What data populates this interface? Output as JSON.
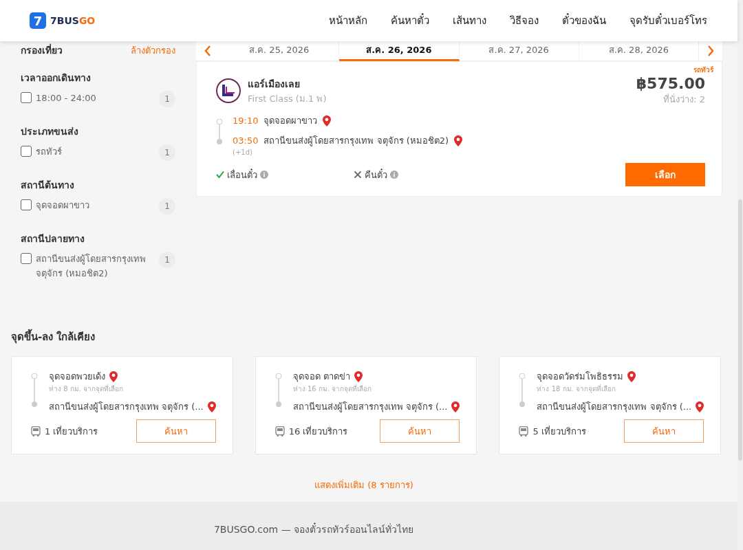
{
  "header": {
    "logo_mark": "7",
    "logo_text_main": "7BUS",
    "logo_text_accent": "GO",
    "nav": [
      "หน้าหลัก",
      "ค้นหาตั๋ว",
      "เส้นทาง",
      "วิธีจอง",
      "ตั๋วของฉัน",
      "จุดรับตั๋วเบอร์โทร"
    ]
  },
  "filters": {
    "title": "กรองเที่ยว",
    "clear": "ล้างตัวกรอง",
    "groups": [
      {
        "title": "เวลาออกเดินทาง",
        "options": [
          {
            "label": "18:00 - 24:00",
            "count": "1",
            "checked": false
          }
        ]
      },
      {
        "title": "ประเภทขนส่ง",
        "options": [
          {
            "label": "รถทัวร์",
            "count": "1",
            "checked": false
          }
        ]
      },
      {
        "title": "สถานีต้นทาง",
        "options": [
          {
            "label": "จุดจอดผาขาว",
            "count": "1",
            "checked": false
          }
        ]
      },
      {
        "title": "สถานีปลายทาง",
        "options": [
          {
            "label": "สถานีขนส่งผู้โดยสารกรุงเทพ จตุจักร (หมอชิต2)",
            "count": "1",
            "checked": false
          }
        ]
      }
    ]
  },
  "date_tabs": [
    {
      "label": "ส.ค. 25, 2026",
      "selected": false
    },
    {
      "label": "ส.ค. 26, 2026",
      "selected": true
    },
    {
      "label": "ส.ค. 27, 2026",
      "selected": false
    },
    {
      "label": "ส.ค. 28, 2026",
      "selected": false
    }
  ],
  "trip": {
    "type_tag": "รถทัวร์",
    "operator": "แอร์เมืองเลย",
    "class": "First Class (ม.1 พ)",
    "price": "฿575.00",
    "seats": "ที่นั่งว่าง: 2",
    "stops": [
      {
        "time": "19:10",
        "place": "จุดจอดผาขาว"
      },
      {
        "time": "03:50",
        "place": "สถานีขนส่งผู้โดยสารกรุงเทพ จตุจักร (หมอชิต2)",
        "day_offset": "(+1d)"
      }
    ],
    "policies": [
      {
        "label": "เลื่อนตั๋ว",
        "allowed": true
      },
      {
        "label": "คืนตั๋ว",
        "allowed": false
      }
    ],
    "select_button": "เลือก"
  },
  "nearby": {
    "title": "จุดขึ้น-ลง ใกล้เคียง",
    "cards": [
      {
        "from": "จุดจอดพวยเด้ง",
        "distance": "ห่าง 8 กม. จากจุดที่เลือก",
        "to": "สถานีขนส่งผู้โดยสารกรุงเทพ จตุจักร (...",
        "trips": "1 เที่ยวบริการ",
        "button": "ค้นหา"
      },
      {
        "from": "จุดจอด ตาดข่า",
        "distance": "ห่าง 16 กม. จากจุดที่เลือก",
        "to": "สถานีขนส่งผู้โดยสารกรุงเทพ จตุจักร (...",
        "trips": "16 เที่ยวบริการ",
        "button": "ค้นหา"
      },
      {
        "from": "จุดจอดวัดร่มโพธิธรรม",
        "distance": "ห่าง 18 กม. จากจุดที่เลือก",
        "to": "สถานีขนส่งผู้โดยสารกรุงเทพ จตุจักร (...",
        "trips": "5 เที่ยวบริการ",
        "button": "ค้นหา"
      }
    ],
    "show_more": "แสดงเพิ่มเติม (8 รายการ)"
  },
  "footer": {
    "text": "7BUSGO.com — จองตั๋วรถทัวร์ออนไลน์ทั่วไทย"
  }
}
